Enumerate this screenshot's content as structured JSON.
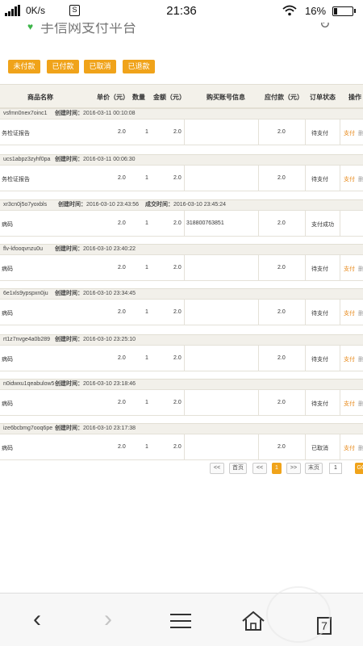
{
  "status": {
    "speed": "0K/s",
    "s_badge": "S",
    "time": "21:36",
    "battery": "16%",
    "wifi": "wifi"
  },
  "urlbar": {
    "title": "手信网支付平台",
    "shield": "shield-icon",
    "refresh": "refresh-icon"
  },
  "filters": [
    "未付款",
    "已付款",
    "已取消",
    "已退款"
  ],
  "headers": {
    "name": "商品名称",
    "unit_price": "单价（元）",
    "qty": "数量",
    "amount": "金额（元）",
    "account": "购买账号信息",
    "payable": "应付款（元）",
    "status": "订单状态",
    "ops": "操作"
  },
  "orders": [
    {
      "order_no": "vsfmn0nex7oinc1",
      "created_label": "创建时间：",
      "created": "2016-03-11 00:10:08",
      "done_label": "",
      "done": "",
      "name": "务检证报告",
      "price": "2.0",
      "qty": "1",
      "amount": "2.0",
      "account": "",
      "payable": "2.0",
      "state": "待支付",
      "pay": "支付",
      "del": "删"
    },
    {
      "order_no": "ucs1abpz3zyhf0pa",
      "created_label": "创建时间：",
      "created": "2016-03-11 00:06:30",
      "done_label": "",
      "done": "",
      "name": "务检证报告",
      "price": "2.0",
      "qty": "1",
      "amount": "2.0",
      "account": "",
      "payable": "2.0",
      "state": "待支付",
      "pay": "支付",
      "del": "删"
    },
    {
      "order_no": "xr3cn0j5o7yoxbls",
      "created_label": "创建时间：",
      "created": "2016-03-10 23:43:56",
      "done_label": "成交时间：",
      "done": "2016-03-10 23:45:24",
      "name": "病码",
      "price": "2.0",
      "qty": "1",
      "amount": "2.0",
      "account": "318800763851",
      "payable": "2.0",
      "state": "支付成功",
      "pay": "",
      "del": ""
    },
    {
      "order_no": "flv-kfooqvnzu0u",
      "created_label": "创建时间：",
      "created": "2016-03-10 23:40:22",
      "done_label": "",
      "done": "",
      "name": "病码",
      "price": "2.0",
      "qty": "1",
      "amount": "2.0",
      "account": "",
      "payable": "2.0",
      "state": "待支付",
      "pay": "支付",
      "del": "删"
    },
    {
      "order_no": "6e1xls9ypspxn0ju",
      "created_label": "创建时间：",
      "created": "2016-03-10 23:34:45",
      "done_label": "",
      "done": "",
      "name": "病码",
      "price": "2.0",
      "qty": "1",
      "amount": "2.0",
      "account": "",
      "payable": "2.0",
      "state": "待支付",
      "pay": "支付",
      "del": "删"
    },
    {
      "order_no": "rt1z7nvge4a0b289",
      "created_label": "创建时间：",
      "created": "2016-03-10 23:25:10",
      "done_label": "",
      "done": "",
      "name": "病码",
      "price": "2.0",
      "qty": "1",
      "amount": "2.0",
      "account": "",
      "payable": "2.0",
      "state": "待支付",
      "pay": "支付",
      "del": "删"
    },
    {
      "order_no": "n0idwxu1qeabulow5",
      "created_label": "创建时间：",
      "created": "2016-03-10 23:18:46",
      "done_label": "",
      "done": "",
      "name": "病码",
      "price": "2.0",
      "qty": "1",
      "amount": "2.0",
      "account": "",
      "payable": "2.0",
      "state": "待支付",
      "pay": "支付",
      "del": "删"
    },
    {
      "order_no": "ize6bcbmg7ooq6pe",
      "created_label": "创建时间：",
      "created": "2016-03-10 23:17:38",
      "done_label": "",
      "done": "",
      "name": "病码",
      "price": "2.0",
      "qty": "1",
      "amount": "2.0",
      "account": "",
      "payable": "2.0",
      "state": "已取消",
      "pay": "支付",
      "del": "删"
    }
  ],
  "pager": {
    "first": "<<",
    "home": "首页",
    "prev": "<<",
    "current": "1",
    "next": ">>",
    "last": "末页",
    "jump_value": "1",
    "go": "GO"
  },
  "navbar": {
    "back": "back-icon",
    "forward": "forward-icon",
    "menu": "menu-icon",
    "home": "home-icon",
    "tabs_count": "7"
  }
}
